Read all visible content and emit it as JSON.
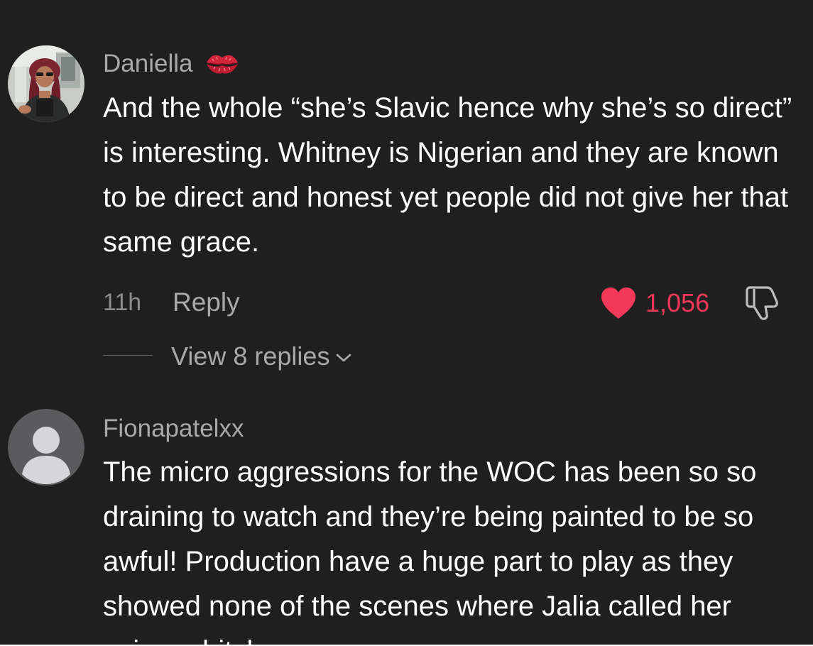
{
  "comments": [
    {
      "username": "Daniella",
      "badge_icon": "kiss-lips-icon",
      "text": "And the whole “she’s Slavic hence why she’s so direct” is interesting. Whitney is Nigerian and they are known to be direct and honest yet people did not give her that same grace.",
      "time": "11h",
      "reply_label": "Reply",
      "like_count": "1,056",
      "liked": true,
      "view_replies_label": "View 8 replies"
    },
    {
      "username": "Fionapatelxx",
      "avatar_icon": "default-avatar-icon",
      "text": "The micro aggressions for the WOC has been so so draining to watch and they’re being painted to be so awful! Production have a huge part to play as they showed none of the scenes where Jalia called her using a bitch or"
    }
  ],
  "colors": {
    "background": "#1f1f1f",
    "text": "#ffffff",
    "muted": "#a9a9a9",
    "like_red": "#f2395a"
  }
}
